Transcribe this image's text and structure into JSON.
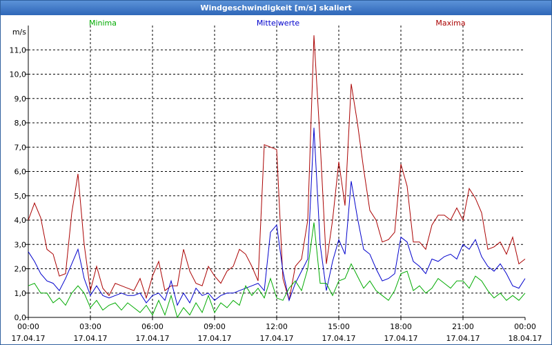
{
  "window": {
    "title": "Windgeschwindigkeit [m/s] skaliert"
  },
  "colors": {
    "minima": "#00aa00",
    "mittelwerte": "#0000cc",
    "maxima": "#aa0000",
    "grid": "#000000",
    "axis": "#000000"
  },
  "chart_data": {
    "type": "line",
    "title": "Windgeschwindigkeit [m/s] skaliert",
    "ylabel": "m/s",
    "ylim": [
      0,
      12
    ],
    "xlim": [
      0,
      24
    ],
    "yticks": [
      "0,0",
      "1,0",
      "2,0",
      "3,0",
      "4,0",
      "5,0",
      "6,0",
      "7,0",
      "8,0",
      "9,0",
      "10,0",
      "11,0"
    ],
    "xticks": [
      {
        "time": "00:00",
        "date": "17.04.17"
      },
      {
        "time": "03:00",
        "date": "17.04.17"
      },
      {
        "time": "06:00",
        "date": "17.04.17"
      },
      {
        "time": "09:00",
        "date": "17.04.17"
      },
      {
        "time": "12:00",
        "date": "17.04.17"
      },
      {
        "time": "15:00",
        "date": "17.04.17"
      },
      {
        "time": "18:00",
        "date": "17.04.17"
      },
      {
        "time": "21:00",
        "date": "17.04.17"
      },
      {
        "time": "00:00",
        "date": "18.04.17"
      }
    ],
    "grid": true,
    "legend_position": "top",
    "series": [
      {
        "name": "Minima",
        "x": [
          0.0,
          0.3,
          0.6,
          0.9,
          1.2,
          1.5,
          1.8,
          2.1,
          2.4,
          2.7,
          3.0,
          3.3,
          3.6,
          3.9,
          4.2,
          4.5,
          4.8,
          5.1,
          5.4,
          5.7,
          6.0,
          6.3,
          6.6,
          6.9,
          7.2,
          7.5,
          7.8,
          8.1,
          8.4,
          8.7,
          9.0,
          9.3,
          9.6,
          9.9,
          10.2,
          10.5,
          10.8,
          11.1,
          11.4,
          11.7,
          12.0,
          12.3,
          12.6,
          12.9,
          13.2,
          13.5,
          13.8,
          14.1,
          14.4,
          14.7,
          15.0,
          15.3,
          15.6,
          15.9,
          16.2,
          16.5,
          16.8,
          17.1,
          17.4,
          17.7,
          18.0,
          18.3,
          18.6,
          18.9,
          19.2,
          19.5,
          19.8,
          20.1,
          20.4,
          20.7,
          21.0,
          21.3,
          21.6,
          21.9,
          22.2,
          22.5,
          22.8,
          23.1,
          23.4,
          23.7,
          24.0
        ],
        "values": [
          1.3,
          1.4,
          1.0,
          1.0,
          0.6,
          0.8,
          0.5,
          1.0,
          1.3,
          1.0,
          0.4,
          0.7,
          0.3,
          0.5,
          0.6,
          0.3,
          0.6,
          0.4,
          0.2,
          0.5,
          0.1,
          0.7,
          0.1,
          0.9,
          0.0,
          0.4,
          0.1,
          0.6,
          0.2,
          0.9,
          0.2,
          0.6,
          0.4,
          0.7,
          0.5,
          1.3,
          0.9,
          1.2,
          0.8,
          1.6,
          0.8,
          0.7,
          1.2,
          1.5,
          1.1,
          2.0,
          3.9,
          1.4,
          1.4,
          0.9,
          1.5,
          1.6,
          2.2,
          1.7,
          1.2,
          1.5,
          1.1,
          0.9,
          0.7,
          1.1,
          1.8,
          1.9,
          1.1,
          1.3,
          1.0,
          1.2,
          1.6,
          1.4,
          1.2,
          1.5,
          1.5,
          1.2,
          1.7,
          1.5,
          1.1,
          0.8,
          1.0,
          0.7,
          0.9,
          0.7,
          1.0
        ]
      },
      {
        "name": "Mittelwerte",
        "x": [
          0.0,
          0.3,
          0.6,
          0.9,
          1.2,
          1.5,
          1.8,
          2.1,
          2.4,
          2.7,
          3.0,
          3.3,
          3.6,
          3.9,
          4.2,
          4.5,
          4.8,
          5.1,
          5.4,
          5.7,
          6.0,
          6.3,
          6.6,
          6.9,
          7.2,
          7.5,
          7.8,
          8.1,
          8.4,
          8.7,
          9.0,
          9.3,
          9.6,
          9.9,
          10.2,
          10.5,
          10.8,
          11.1,
          11.4,
          11.7,
          12.0,
          12.3,
          12.6,
          12.9,
          13.2,
          13.5,
          13.8,
          14.1,
          14.4,
          14.7,
          15.0,
          15.3,
          15.6,
          15.9,
          16.2,
          16.5,
          16.8,
          17.1,
          17.4,
          17.7,
          18.0,
          18.3,
          18.6,
          18.9,
          19.2,
          19.5,
          19.8,
          20.1,
          20.4,
          20.7,
          21.0,
          21.3,
          21.6,
          21.9,
          22.2,
          22.5,
          22.8,
          23.1,
          23.4,
          23.7,
          24.0
        ],
        "values": [
          2.7,
          2.3,
          1.8,
          1.5,
          1.4,
          1.1,
          1.6,
          2.2,
          2.8,
          1.6,
          0.9,
          1.3,
          0.9,
          0.8,
          0.9,
          1.0,
          0.9,
          0.9,
          1.0,
          0.6,
          0.9,
          1.0,
          0.7,
          1.5,
          0.5,
          1.0,
          0.6,
          1.2,
          0.9,
          1.0,
          0.7,
          0.9,
          1.0,
          1.0,
          1.1,
          1.2,
          1.3,
          1.4,
          1.1,
          3.5,
          3.8,
          1.9,
          0.7,
          1.4,
          1.9,
          2.4,
          7.8,
          3.0,
          1.1,
          2.3,
          3.2,
          2.6,
          5.6,
          4.1,
          2.8,
          2.6,
          2.0,
          1.5,
          1.6,
          1.8,
          3.3,
          3.1,
          2.3,
          2.1,
          1.8,
          2.4,
          2.3,
          2.5,
          2.6,
          2.4,
          3.0,
          2.8,
          3.2,
          2.5,
          2.1,
          1.9,
          2.2,
          1.8,
          1.3,
          1.2,
          1.6
        ]
      },
      {
        "name": "Maxima",
        "x": [
          0.0,
          0.3,
          0.6,
          0.9,
          1.2,
          1.5,
          1.8,
          2.1,
          2.4,
          2.7,
          3.0,
          3.3,
          3.6,
          3.9,
          4.2,
          4.5,
          4.8,
          5.1,
          5.4,
          5.7,
          6.0,
          6.3,
          6.6,
          6.9,
          7.2,
          7.5,
          7.8,
          8.1,
          8.4,
          8.7,
          9.0,
          9.3,
          9.6,
          9.9,
          10.2,
          10.5,
          10.8,
          11.1,
          11.4,
          11.7,
          12.0,
          12.3,
          12.6,
          12.9,
          13.2,
          13.5,
          13.8,
          14.1,
          14.4,
          14.7,
          15.0,
          15.3,
          15.6,
          15.9,
          16.2,
          16.5,
          16.8,
          17.1,
          17.4,
          17.7,
          18.0,
          18.3,
          18.6,
          18.9,
          19.2,
          19.5,
          19.8,
          20.1,
          20.4,
          20.7,
          21.0,
          21.3,
          21.6,
          21.9,
          22.2,
          22.5,
          22.8,
          23.1,
          23.4,
          23.7,
          24.0
        ],
        "values": [
          4.0,
          4.7,
          4.1,
          2.8,
          2.6,
          1.7,
          1.8,
          4.3,
          5.9,
          3.0,
          1.1,
          2.1,
          1.2,
          0.9,
          1.4,
          1.3,
          1.2,
          1.1,
          1.6,
          0.8,
          1.7,
          2.3,
          1.1,
          1.3,
          1.3,
          2.8,
          1.9,
          1.4,
          1.3,
          2.1,
          1.7,
          1.4,
          1.9,
          2.1,
          2.8,
          2.6,
          2.1,
          1.5,
          7.1,
          7.0,
          6.9,
          1.6,
          0.7,
          2.1,
          2.4,
          4.0,
          11.6,
          7.2,
          2.2,
          4.0,
          6.4,
          4.6,
          9.6,
          8.0,
          6.1,
          4.4,
          4.0,
          3.1,
          3.2,
          3.5,
          6.3,
          5.4,
          3.1,
          3.1,
          2.8,
          3.8,
          4.2,
          4.2,
          4.0,
          4.5,
          4.0,
          5.3,
          4.9,
          4.3,
          2.8,
          2.9,
          3.1,
          2.6,
          3.3,
          2.2,
          2.4
        ]
      }
    ]
  }
}
